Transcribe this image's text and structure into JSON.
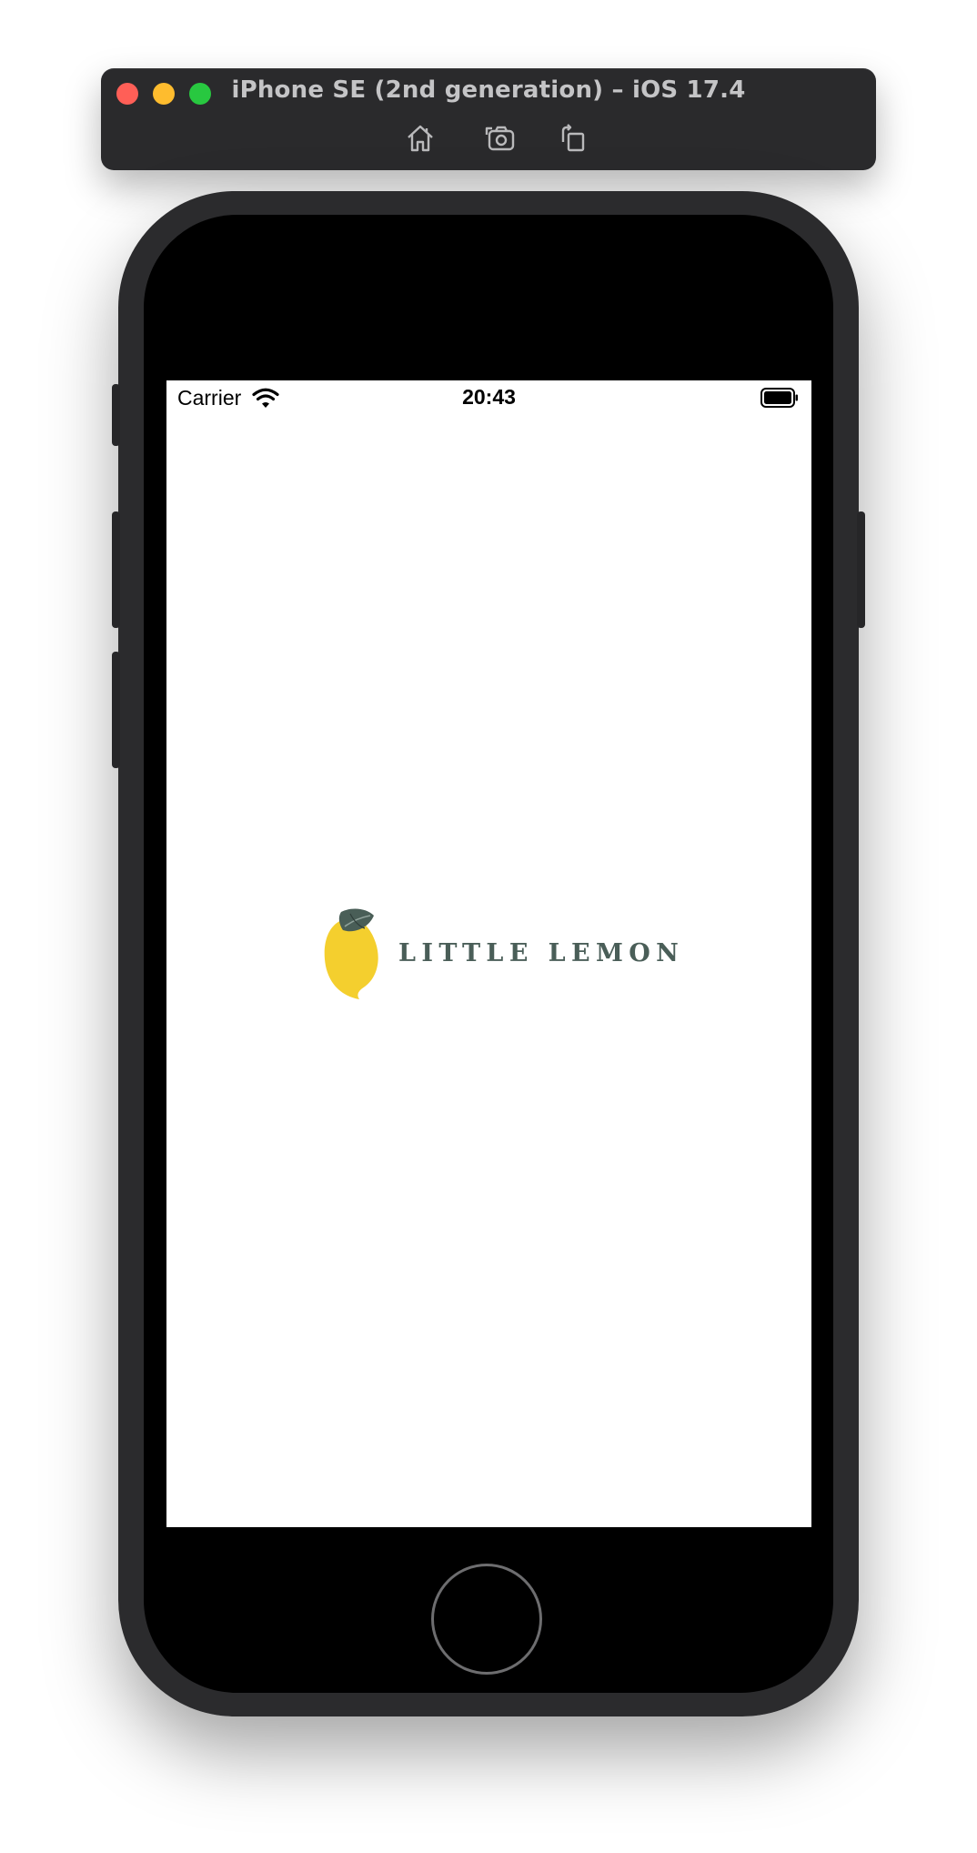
{
  "simulator": {
    "title": "iPhone SE (2nd generation) – iOS 17.4",
    "window_controls": [
      "close-icon",
      "minimize-icon",
      "zoom-icon"
    ],
    "toolbar_icons": [
      "home-icon",
      "screenshot-icon",
      "rotate-icon"
    ]
  },
  "status_bar": {
    "carrier": "Carrier",
    "time": "20:43",
    "icons": [
      "wifi-icon",
      "battery-icon"
    ]
  },
  "app": {
    "logo_text": "LITTLE LEMON",
    "logo_icon": "lemon-icon",
    "colors": {
      "lemon": "#f4cf2e",
      "leaf": "#495e57",
      "text": "#495e57",
      "background": "#ffffff"
    }
  }
}
